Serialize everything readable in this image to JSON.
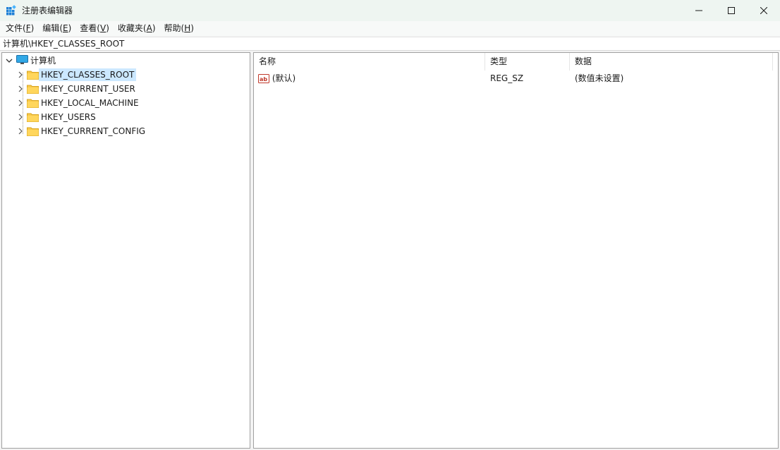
{
  "window": {
    "title": "注册表编辑器",
    "accent": "#0078d4"
  },
  "menu": [
    {
      "label": "文件",
      "accel": "F"
    },
    {
      "label": "编辑",
      "accel": "E"
    },
    {
      "label": "查看",
      "accel": "V"
    },
    {
      "label": "收藏夹",
      "accel": "A"
    },
    {
      "label": "帮助",
      "accel": "H"
    }
  ],
  "address": "计算机\\HKEY_CLASSES_ROOT",
  "tree": {
    "root": {
      "label": "计算机",
      "icon": "computer-icon"
    },
    "children": [
      {
        "label": "HKEY_CLASSES_ROOT",
        "selected": true
      },
      {
        "label": "HKEY_CURRENT_USER"
      },
      {
        "label": "HKEY_LOCAL_MACHINE"
      },
      {
        "label": "HKEY_USERS"
      },
      {
        "label": "HKEY_CURRENT_CONFIG"
      }
    ]
  },
  "list": {
    "columns": [
      "名称",
      "类型",
      "数据"
    ],
    "rows": [
      {
        "name": "(默认)",
        "type": "REG_SZ",
        "data": "(数值未设置)",
        "icon": "string-value-icon"
      }
    ]
  }
}
